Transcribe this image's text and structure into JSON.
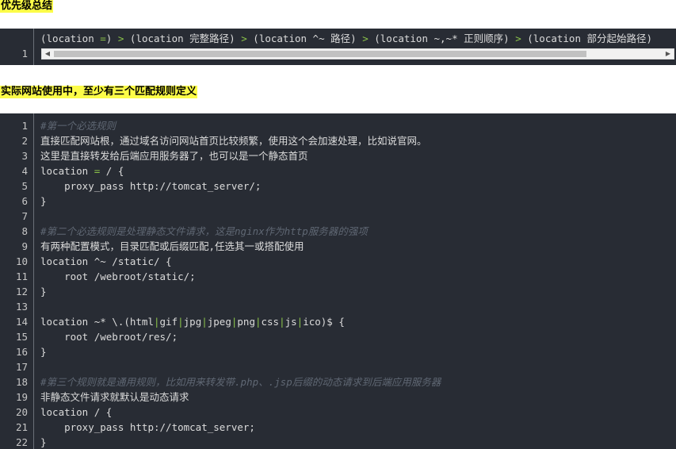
{
  "headings": {
    "priority": "优先级总结",
    "practice": "实际网站使用中，至少有三个匹配规则定义"
  },
  "block1": {
    "line_number": "1",
    "segments": [
      {
        "t": "(location ",
        "c": "pl"
      },
      {
        "t": "=",
        "c": "op"
      },
      {
        "t": ") ",
        "c": "pl"
      },
      {
        "t": ">",
        "c": "op"
      },
      {
        "t": " (location 完整路径) ",
        "c": "pl"
      },
      {
        "t": ">",
        "c": "op"
      },
      {
        "t": " (location ^~ 路径) ",
        "c": "pl"
      },
      {
        "t": ">",
        "c": "op"
      },
      {
        "t": " (location ~,~* 正则顺序) ",
        "c": "pl"
      },
      {
        "t": ">",
        "c": "op"
      },
      {
        "t": " (location 部分起始路径)",
        "c": "pl"
      }
    ],
    "scroll_left_glyph": "◀",
    "scroll_right_glyph": "▶"
  },
  "block2": {
    "lines": [
      {
        "n": "1",
        "segs": [
          {
            "t": "#第一个必选规则",
            "c": "cm"
          }
        ]
      },
      {
        "n": "2",
        "segs": [
          {
            "t": "直接匹配网站根，通过域名访问网站首页比较频繁，使用这个会加速处理，比如说官网。",
            "c": "pl"
          }
        ]
      },
      {
        "n": "3",
        "segs": [
          {
            "t": "这里是直接转发给后端应用服务器了，也可以是一个静态首页",
            "c": "pl"
          }
        ]
      },
      {
        "n": "4",
        "segs": [
          {
            "t": "location ",
            "c": "pl"
          },
          {
            "t": "=",
            "c": "op"
          },
          {
            "t": " / {",
            "c": "pl"
          }
        ]
      },
      {
        "n": "5",
        "segs": [
          {
            "t": "    proxy_pass http://tomcat_server/;",
            "c": "pl"
          }
        ]
      },
      {
        "n": "6",
        "segs": [
          {
            "t": "}",
            "c": "pl"
          }
        ]
      },
      {
        "n": "7",
        "segs": []
      },
      {
        "n": "8",
        "segs": [
          {
            "t": "#第二个必选规则是处理静态文件请求，这是nginx作为http服务器的强项",
            "c": "cm"
          }
        ]
      },
      {
        "n": "9",
        "segs": [
          {
            "t": "有两种配置模式，目录匹配或后缀匹配,任选其一或搭配使用",
            "c": "pl"
          }
        ]
      },
      {
        "n": "10",
        "segs": [
          {
            "t": "location ^~ /static/ {",
            "c": "pl"
          }
        ]
      },
      {
        "n": "11",
        "segs": [
          {
            "t": "    root /webroot/static/;",
            "c": "pl"
          }
        ]
      },
      {
        "n": "12",
        "segs": [
          {
            "t": "}",
            "c": "pl"
          }
        ]
      },
      {
        "n": "13",
        "segs": []
      },
      {
        "n": "14",
        "segs": [
          {
            "t": "location ~* \\.(html",
            "c": "pl"
          },
          {
            "t": "|",
            "c": "pipe"
          },
          {
            "t": "gif",
            "c": "pl"
          },
          {
            "t": "|",
            "c": "pipe"
          },
          {
            "t": "jpg",
            "c": "pl"
          },
          {
            "t": "|",
            "c": "pipe"
          },
          {
            "t": "jpeg",
            "c": "pl"
          },
          {
            "t": "|",
            "c": "pipe"
          },
          {
            "t": "png",
            "c": "pl"
          },
          {
            "t": "|",
            "c": "pipe"
          },
          {
            "t": "css",
            "c": "pl"
          },
          {
            "t": "|",
            "c": "pipe"
          },
          {
            "t": "js",
            "c": "pl"
          },
          {
            "t": "|",
            "c": "pipe"
          },
          {
            "t": "ico)$ {",
            "c": "pl"
          }
        ]
      },
      {
        "n": "15",
        "segs": [
          {
            "t": "    root /webroot/res/;",
            "c": "pl"
          }
        ]
      },
      {
        "n": "16",
        "segs": [
          {
            "t": "}",
            "c": "pl"
          }
        ]
      },
      {
        "n": "17",
        "segs": []
      },
      {
        "n": "18",
        "segs": [
          {
            "t": "#第三个规则就是通用规则，比如用来转发带.php、.jsp后缀的动态请求到后端应用服务器",
            "c": "cm"
          }
        ]
      },
      {
        "n": "19",
        "segs": [
          {
            "t": "非静态文件请求就默认是动态请求",
            "c": "pl"
          }
        ]
      },
      {
        "n": "20",
        "segs": [
          {
            "t": "location / {",
            "c": "pl"
          }
        ]
      },
      {
        "n": "21",
        "segs": [
          {
            "t": "    proxy_pass http://tomcat_server;",
            "c": "pl"
          }
        ]
      },
      {
        "n": "22",
        "segs": [
          {
            "t": "}",
            "c": "pl"
          }
        ]
      }
    ]
  }
}
